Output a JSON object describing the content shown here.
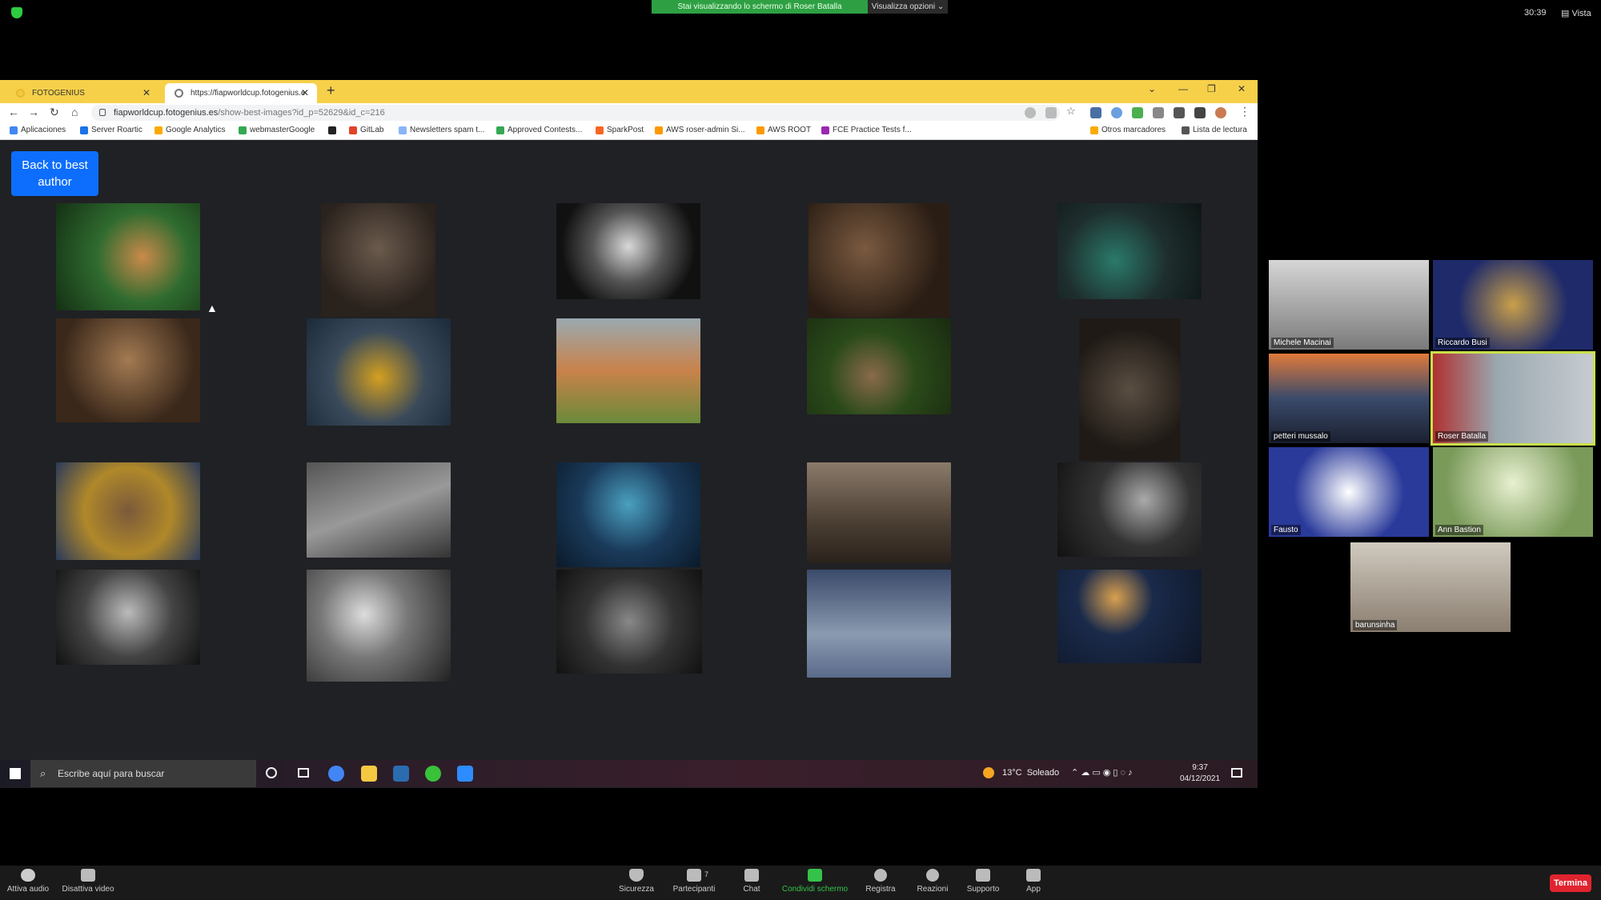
{
  "zoom_top": {
    "share_banner": "Stai visualizzando lo schermo di Roser Batalla",
    "view_options": "Visualizza opzioni ⌄",
    "clock": "30:39",
    "view_label": "Vista"
  },
  "browser": {
    "tabs": [
      {
        "label": "FOTOGENIUS"
      },
      {
        "label": "https://fiapworldcup.fotogenius.e"
      }
    ],
    "url_host": "fiapworldcup.fotogenius.es",
    "url_path": "/show-best-images?id_p=52629&id_c=216",
    "bookmarks": [
      {
        "label": "Aplicaciones",
        "color": "#4285f4"
      },
      {
        "label": "Server Roartic",
        "color": "#1a73e8"
      },
      {
        "label": "Google Analytics",
        "color": "#f9ab00"
      },
      {
        "label": "webmasterGoogle",
        "color": "#34a853"
      },
      {
        "label": "",
        "color": "#222"
      },
      {
        "label": "GitLab",
        "color": "#e24329"
      },
      {
        "label": "Newsletters spam t...",
        "color": "#8ab4f8"
      },
      {
        "label": "Approved Contests...",
        "color": "#34a853"
      },
      {
        "label": "SparkPost",
        "color": "#fa6423"
      },
      {
        "label": "AWS roser-admin Si...",
        "color": "#ff9900"
      },
      {
        "label": "AWS ROOT",
        "color": "#ff9900"
      },
      {
        "label": "FCE Practice Tests f...",
        "color": "#9c27b0"
      },
      {
        "label": "Otros marcadores",
        "color": "#f9ab00"
      },
      {
        "label": "Lista de lectura",
        "color": "#555"
      }
    ]
  },
  "page": {
    "back_button_line1": "Back to best",
    "back_button_line2": "author"
  },
  "taskbar": {
    "search_placeholder": "Escribe aquí para buscar",
    "temperature": "13°C",
    "weather": "Soleado",
    "time": "9:37",
    "date": "04/12/2021"
  },
  "participants": [
    {
      "name": "Michele Macinai"
    },
    {
      "name": "Riccardo Busi"
    },
    {
      "name": "petteri mussalo"
    },
    {
      "name": "Roser Batalla"
    },
    {
      "name": "Fausto"
    },
    {
      "name": "Ann Bastion"
    },
    {
      "name": "barunsinha"
    }
  ],
  "zoom_bottom": {
    "mute": "Attiva audio",
    "video": "Disattiva video",
    "security": "Sicurezza",
    "participants": "Partecipanti",
    "participants_count": "7",
    "chat": "Chat",
    "share": "Condividi schermo",
    "record": "Registra",
    "reactions": "Reazioni",
    "support": "Supporto",
    "apps": "App",
    "end": "Termina"
  },
  "colors": {
    "share_green": "#2ea043",
    "tab_bar_yellow": "#f7d04a",
    "back_button_blue": "#0d6efd",
    "end_red": "#e0242f",
    "active_speaker": "#c9e04a"
  }
}
